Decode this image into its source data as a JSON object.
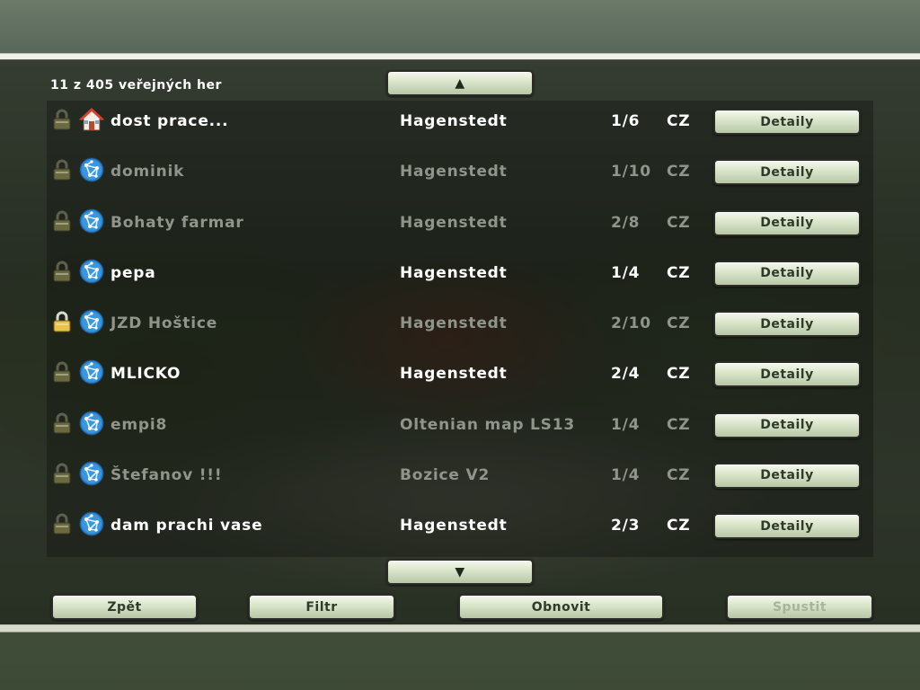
{
  "header": {
    "count_label": "11 z 405 veřejných her"
  },
  "scroll": {
    "up_icon": "▲",
    "down_icon": "▼"
  },
  "servers": [
    {
      "name": "dost prace...",
      "map": "Hagenstedt",
      "players": "1/6",
      "lang": "CZ",
      "details_label": "Detaily",
      "locked": false,
      "type_icon": "house-icon",
      "active": true
    },
    {
      "name": "dominik",
      "map": "Hagenstedt",
      "players": "1/10",
      "lang": "CZ",
      "details_label": "Detaily",
      "locked": false,
      "type_icon": "network-icon",
      "active": false
    },
    {
      "name": "Bohaty farmar",
      "map": "Hagenstedt",
      "players": "2/8",
      "lang": "CZ",
      "details_label": "Detaily",
      "locked": false,
      "type_icon": "network-icon",
      "active": false
    },
    {
      "name": "pepa",
      "map": "Hagenstedt",
      "players": "1/4",
      "lang": "CZ",
      "details_label": "Detaily",
      "locked": false,
      "type_icon": "network-icon",
      "active": true
    },
    {
      "name": "JZD Hoštice",
      "map": "Hagenstedt",
      "players": "2/10",
      "lang": "CZ",
      "details_label": "Detaily",
      "locked": true,
      "type_icon": "network-icon",
      "active": false
    },
    {
      "name": "MLICKO",
      "map": "Hagenstedt",
      "players": "2/4",
      "lang": "CZ",
      "details_label": "Detaily",
      "locked": false,
      "type_icon": "network-icon",
      "active": true
    },
    {
      "name": "empi8",
      "map": "Oltenian map LS13",
      "players": "1/4",
      "lang": "CZ",
      "details_label": "Detaily",
      "locked": false,
      "type_icon": "network-icon",
      "active": false
    },
    {
      "name": "Štefanov !!!",
      "map": "Bozice V2",
      "players": "1/4",
      "lang": "CZ",
      "details_label": "Detaily",
      "locked": false,
      "type_icon": "network-icon",
      "active": false
    },
    {
      "name": "dam prachi vase",
      "map": "Hagenstedt",
      "players": "2/3",
      "lang": "CZ",
      "details_label": "Detaily",
      "locked": false,
      "type_icon": "network-icon",
      "active": true
    }
  ],
  "footer": {
    "back_label": "Zpět",
    "filter_label": "Filtr",
    "refresh_label": "Obnovit",
    "start_label": "Spustit"
  }
}
